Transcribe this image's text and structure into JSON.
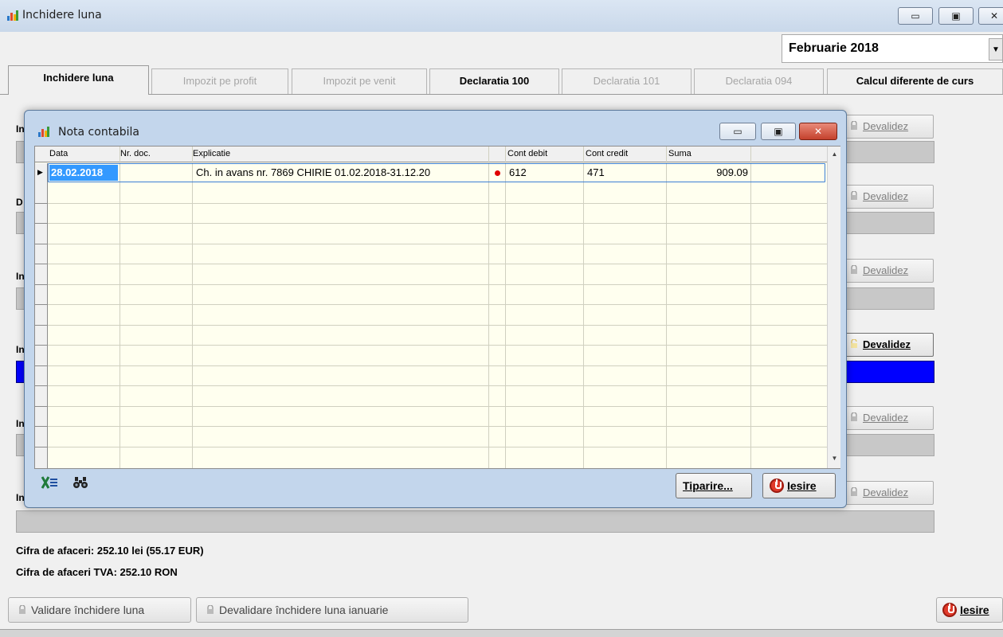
{
  "window": {
    "title": "Inchidere luna"
  },
  "period": {
    "month_label": "Februarie  2018"
  },
  "tabs": [
    {
      "label": "Inchidere luna"
    },
    {
      "label": "Impozit pe profit"
    },
    {
      "label": "Impozit pe venit"
    },
    {
      "label": "Declaratia 100"
    },
    {
      "label": "Declaratia 101"
    },
    {
      "label": "Declaratia 094"
    },
    {
      "label": "Calcul diferente de curs"
    }
  ],
  "sections": [
    {
      "label_visible": "In"
    },
    {
      "label_visible": "D"
    },
    {
      "label_visible": "In"
    },
    {
      "label_visible": "In"
    },
    {
      "label_visible": "In"
    },
    {
      "label_visible": "In"
    }
  ],
  "devalidez_label": "Devalidez",
  "info": {
    "cifra_afaceri": "Cifra de afaceri: 252.10 lei (55.17 EUR)",
    "cifra_afaceri_tva": "Cifra de afaceri TVA: 252.10 RON"
  },
  "bottom_buttons": {
    "validare": "Validare închidere luna",
    "devalidare": "Devalidare închidere luna ianuarie",
    "iesire": "Iesire"
  },
  "dialog": {
    "title": "Nota contabila",
    "columns": [
      "Data",
      "Nr. doc.",
      "Explicatie",
      "Cont debit",
      "Cont credit",
      "Suma"
    ],
    "rows": [
      {
        "data": "28.02.2018",
        "nr_doc": "",
        "explicatie": "Ch. in avans nr. 7869 CHIRIE 01.02.2018-31.12.20",
        "cont_debit": "612",
        "cont_credit": "471",
        "suma": "909.09"
      }
    ],
    "buttons": {
      "tiparire": "Tiparire...",
      "iesire": "Iesire"
    }
  }
}
